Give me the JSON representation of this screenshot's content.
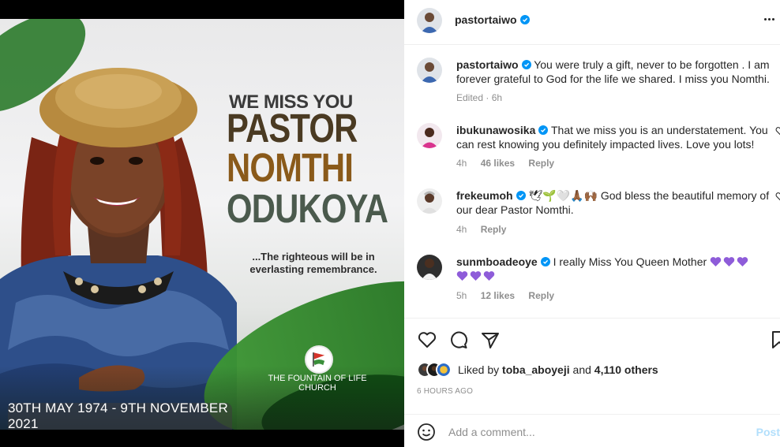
{
  "colors": {
    "verified": "#0095f6",
    "link_disabled": "#b2dffc",
    "muted": "#8e8e8e"
  },
  "poster": {
    "kicker": "WE MISS YOU",
    "name_lines": [
      "PASTOR",
      "NOMTHI",
      "ODUKOYA"
    ],
    "quote": "...The righteous will be in everlasting remembrance.",
    "church": "THE FOUNTAIN OF LIFE CHURCH",
    "dates": "30TH MAY 1974 - 9TH NOVEMBER 2021"
  },
  "header": {
    "username": "pastortaiwo",
    "more_icon": "more-horizontal-icon"
  },
  "comments": [
    {
      "username": "pastortaiwo",
      "text": "You were truly a gift, never to be forgotten . I am forever grateful to God for the life we shared. I miss you Nomthi.",
      "time": "Edited · 6h"
    },
    {
      "username": "ibukunawosika",
      "text": "That we miss you is an understatement. You can rest knowing you definitely impacted lives. Love you lots!",
      "time": "4h",
      "likes": "46 likes",
      "reply": "Reply"
    },
    {
      "username": "frekeumoh",
      "emojis": "🕊🌱🤍🙏🏾🙌🏾",
      "text": "God bless the beautiful memory of our dear Pastor Nomthi.",
      "time": "4h",
      "reply": "Reply"
    },
    {
      "username": "sunmboadeoye",
      "text": "I really Miss You Queen Mother",
      "time": "5h",
      "likes": "12 likes",
      "reply": "Reply"
    }
  ],
  "likes": {
    "prefix": "Liked by",
    "user": "toba_aboyeji",
    "middle": "and",
    "count": "4,110 others"
  },
  "post_time": "6 HOURS AGO",
  "comment_box": {
    "placeholder": "Add a comment...",
    "post_label": "Post"
  }
}
